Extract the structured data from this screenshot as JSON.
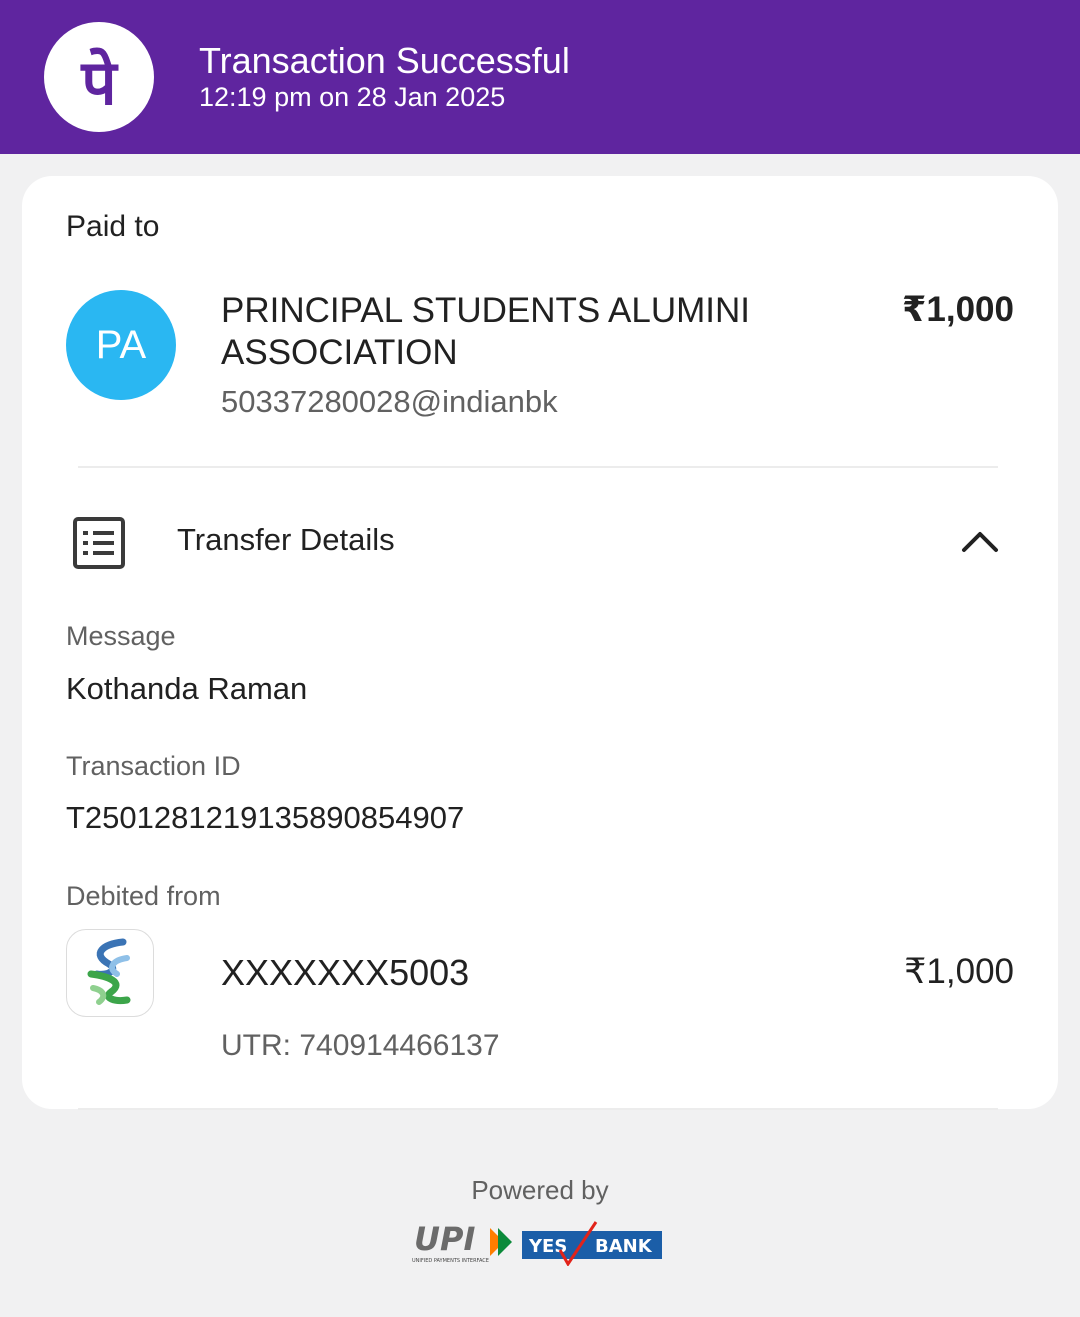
{
  "header": {
    "title": "Transaction Successful",
    "subtitle": "12:19 pm on 28 Jan 2025",
    "logo_text": "पे",
    "brand_color": "#5f259f"
  },
  "paid_to": {
    "label": "Paid to",
    "avatar_initials": "PA",
    "avatar_color": "#2ab7f2",
    "name": "PRINCIPAL STUDENTS ALUMINI ASSOCIATION",
    "upi_id": "50337280028@indianbk",
    "amount": "₹1,000"
  },
  "transfer_details": {
    "label": "Transfer Details",
    "icon": "receipt-list-icon",
    "toggle_icon": "chevron-up-icon",
    "message_label": "Message",
    "message_value": "Kothanda Raman",
    "transaction_id_label": "Transaction ID",
    "transaction_id_value": "T2501281219135890854907",
    "debited_from_label": "Debited from",
    "account_number": "XXXXXXX5003",
    "debit_amount": "₹1,000",
    "utr": "UTR: 740914466137",
    "bank_icon": "standard-chartered-logo-icon"
  },
  "footer": {
    "powered_by": "Powered by",
    "upi_logo_text": "UPI",
    "upi_tagline": "UNIFIED PAYMENTS INTERFACE",
    "yes_text": "YES",
    "bank_text": "BANK"
  }
}
